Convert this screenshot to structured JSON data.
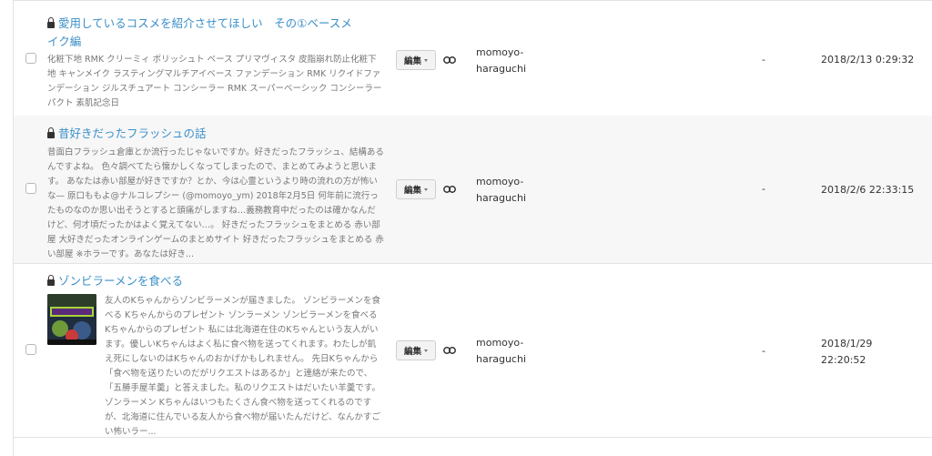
{
  "posts": [
    {
      "title": "愛用しているコスメを紹介させてほしい　その①ベースメイク編",
      "excerpt": "化粧下地 RMK クリーミィ ポリッシュト ベース プリマヴィスタ 皮脂崩れ防止化粧下地 キャンメイク ラスティングマルチアイベース ファンデーション RMK リクイドファンデーション ジルスチュアート コンシーラー RMK スーパーベーシック コンシーラーパクト 素肌記念日",
      "edit_label": "編集",
      "author": "momoyo-haraguchi",
      "views": "-",
      "date": "2018/2/13 0:29:32"
    },
    {
      "title": "昔好きだったフラッシュの話",
      "excerpt": "昔面白フラッシュ倉庫とか流行ったじゃないですか。好きだったフラッシュ、結構あるんですよね。 色々調べてたら懐かしくなってしまったので、まとめてみようと思います。 あなたは赤い部屋が好きですか？とか、今は心霊というより時の流れの方が怖いな— 原口ももよ@ナルコレプシー (@momoyo_ym) 2018年2月5日 何年前に流行ったものなのか思い出そうとすると頭痛がしますね…義務教育中だったのは確かなんだけど、何才頃だったかはよく覚えてない…。 好きだったフラッシュをまとめる 赤い部屋 大好きだったオンラインゲームのまとめサイト 好きだったフラッシュをまとめる 赤い部屋 ※ホラーです。あなたは好き...",
      "edit_label": "編集",
      "author": "momoyo-haraguchi",
      "views": "-",
      "date": "2018/2/6 22:33:15"
    },
    {
      "title": "ゾンビラーメンを食べる",
      "excerpt": "友人のKちゃんからゾンビラーメンが届きました。 ゾンビラーメンを食べる Kちゃんからのプレゼント ゾンラーメン ゾンビラーメンを食べる Kちゃんからのプレゼント 私には北海道在住のKちゃんという友人がいます。優しいKちゃんはよく私に食べ物を送ってくれます。わたしが飢え死にしないのはKちゃんのおかげかもしれません。 先日Kちゃんから「食べ物を送りたいのだがリクエストはあるか」と連絡が来たので、「五勝手屋羊羹」と答えました。私のリクエストはだいたい羊羹です。 ゾンラーメン Kちゃんはいつもたくさん食べ物を送ってくれるのですが、北海道に住んでいる友人から食べ物が届いたんだけど、なんかすごい怖いラー...",
      "edit_label": "編集",
      "author": "momoyo-haraguchi",
      "views": "-",
      "date": "2018/1/29 22:20:52"
    }
  ],
  "icons": {
    "lock": "lock-icon",
    "link": "link-icon",
    "caret": "chevron-down-icon"
  },
  "colors": {
    "title_link": "#3a8fc8",
    "row_alt_bg": "#f7f7f8",
    "excerpt_text": "#777777"
  }
}
